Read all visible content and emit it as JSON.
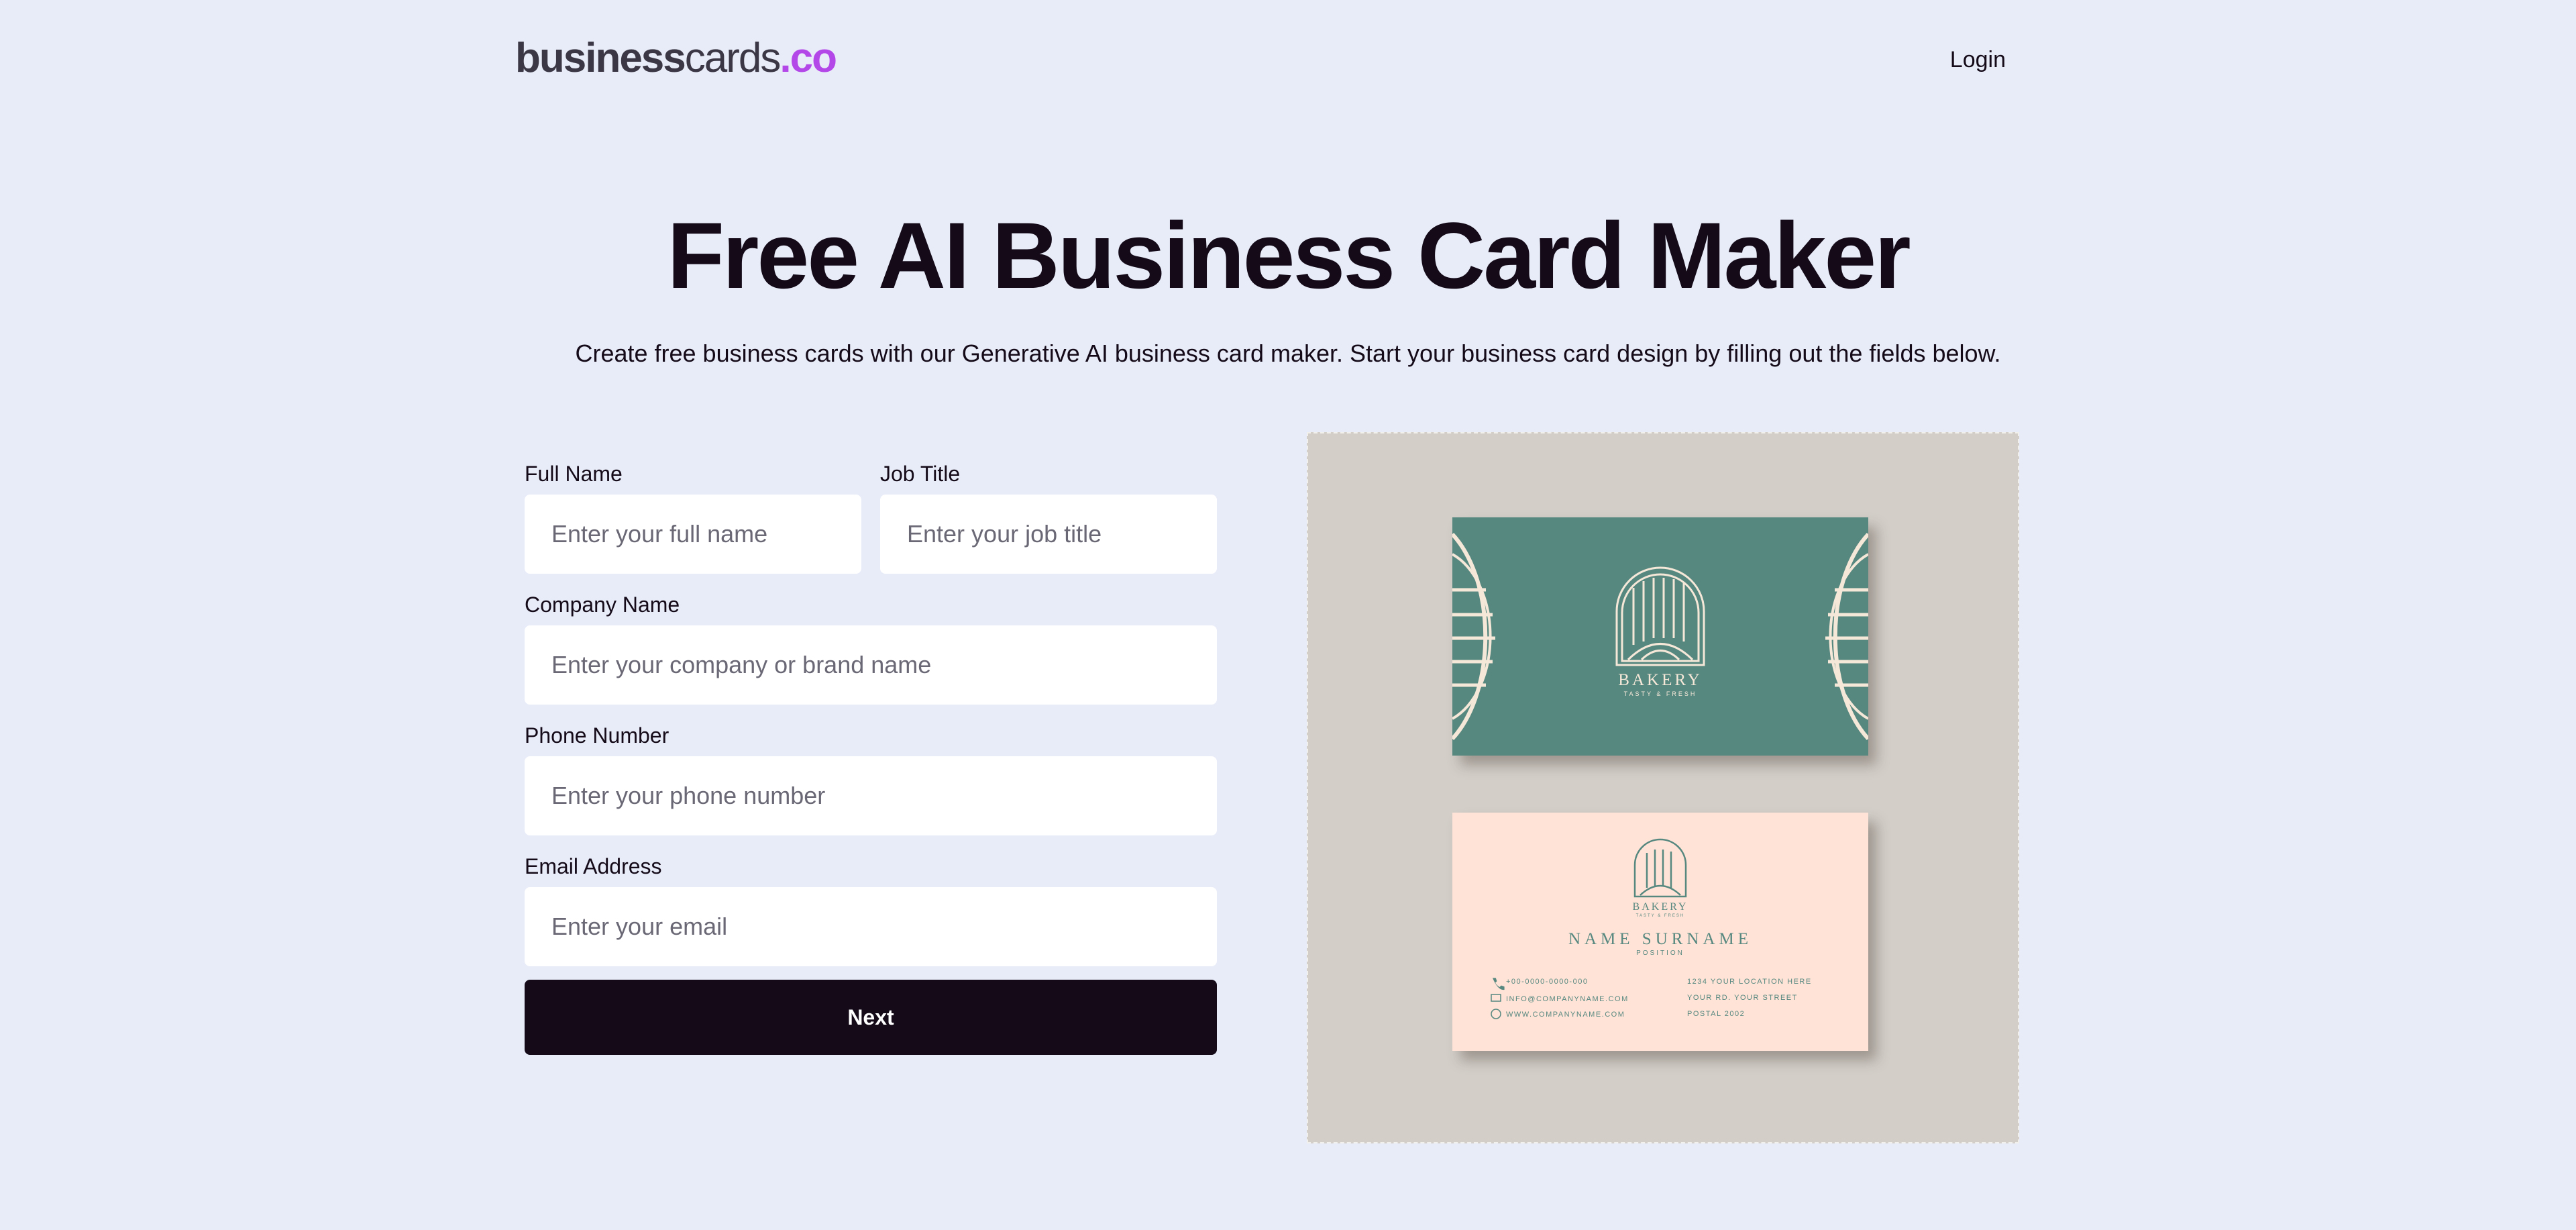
{
  "header": {
    "logo": {
      "part1": "business",
      "part2": "cards",
      "part3": ".co"
    },
    "login_label": "Login"
  },
  "hero": {
    "title": "Free AI Business Card Maker",
    "subtitle": "Create free business cards with our Generative AI business card maker. Start your business card design by filling out the fields below."
  },
  "form": {
    "full_name": {
      "label": "Full Name",
      "placeholder": "Enter your full name",
      "value": ""
    },
    "job_title": {
      "label": "Job Title",
      "placeholder": "Enter your job title",
      "value": ""
    },
    "company": {
      "label": "Company Name",
      "placeholder": "Enter your company or brand name",
      "value": ""
    },
    "phone": {
      "label": "Phone Number",
      "placeholder": "Enter your phone number",
      "value": ""
    },
    "email": {
      "label": "Email Address",
      "placeholder": "Enter your email",
      "value": ""
    },
    "next_label": "Next"
  },
  "preview": {
    "front": {
      "brand": "BAKERY",
      "tagline": "TASTY & FRESH"
    },
    "back": {
      "brand": "BAKERY",
      "tagline": "TASTY & FRESH",
      "name": "NAME SURNAME",
      "position": "POSITION",
      "phone": "+00-0000-0000-000",
      "email": "INFO@COMPANYNAME.COM",
      "website": "WWW.COMPANYNAME.COM",
      "address1": "1234 YOUR LOCATION HERE",
      "address2": "YOUR RD. YOUR STREET",
      "address3": "POSTAL 2002"
    }
  },
  "colors": {
    "background": "#e8ecf8",
    "primary": "#140a18",
    "accent": "#b347e8",
    "card_front": "#578880",
    "card_back": "#fee3d6",
    "card_ink": "#f6e8d8",
    "preview_bg": "#d3cec8"
  }
}
